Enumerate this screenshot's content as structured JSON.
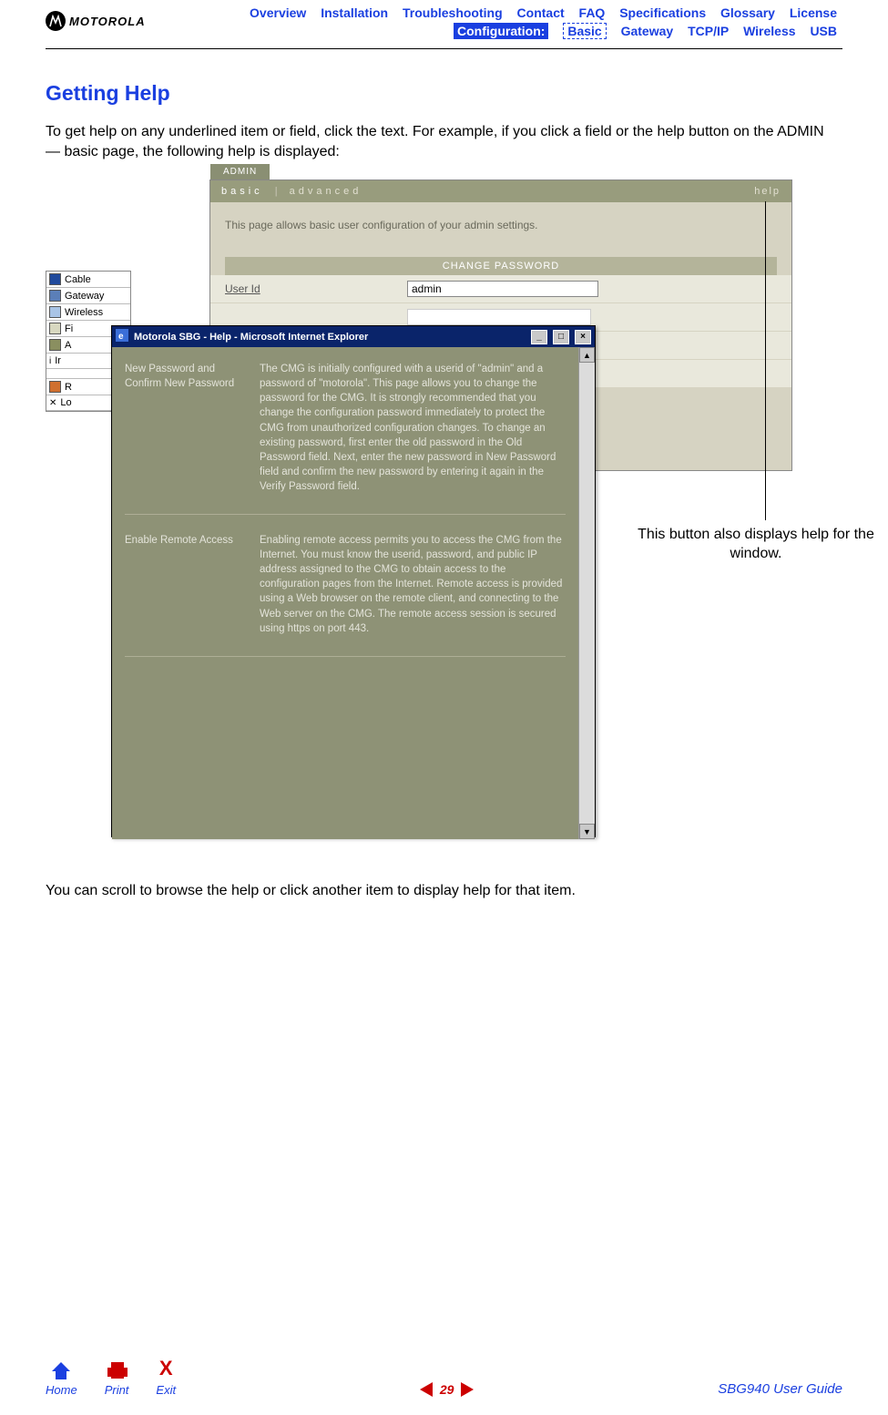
{
  "header": {
    "logo_text": "MOTOROLA",
    "nav1": [
      "Overview",
      "Installation",
      "Troubleshooting",
      "Contact",
      "FAQ",
      "Specifications",
      "Glossary",
      "License"
    ],
    "config_label": "Configuration:",
    "nav2": [
      "Basic",
      "Gateway",
      "TCP/IP",
      "Wireless",
      "USB"
    ]
  },
  "section_title": "Getting Help",
  "para1": "To get help on any underlined item or field, click the text. For example, if you click a field or the help button on the ADMIN — basic page, the following help is displayed:",
  "para2": "You can scroll to browse the help or click another item to display help for that item.",
  "callout": "This button also displays help for the window.",
  "admin": {
    "tab": "ADMIN",
    "sub_basic": "basic",
    "sub_sep": "|",
    "sub_adv": "advanced",
    "sub_help": "help",
    "desc": "This page allows basic user configuration of your admin settings.",
    "chpw": "CHANGE PASSWORD",
    "userid_label": "User Id",
    "userid_value": "admin"
  },
  "sidenav": {
    "items": [
      {
        "label": "Cable",
        "color": "#214a9c"
      },
      {
        "label": "Gateway",
        "color": "#5b7fb8"
      },
      {
        "label": "Wireless",
        "color": "#a9c4e6"
      },
      {
        "label": "Fi",
        "color": "#d8d8c0"
      },
      {
        "label": "A",
        "color": "#8a8f60"
      },
      {
        "label": "Ir",
        "color": "#fff"
      },
      {
        "label": "",
        "color": "#fff"
      },
      {
        "label": "R",
        "color": "#d07030"
      },
      {
        "label": "Lo",
        "color": "#bcbcbc"
      }
    ]
  },
  "help": {
    "title": "Motorola SBG - Help - Microsoft Internet Explorer",
    "min": "_",
    "max": "□",
    "close": "×",
    "up": "▲",
    "down": "▼",
    "rows": [
      {
        "k": "New Password and Confirm New Password",
        "v": "The CMG is initially configured with a userid of \"admin\" and a password of \"motorola\". This page allows you to change the password for the CMG. It is strongly recommended that you change the configuration password immediately to protect the CMG from unauthorized configuration changes. To change an existing password, first enter the old password in the Old Password field. Next, enter the new password in New Password field and confirm the new password by entering it again in the Verify Password field."
      },
      {
        "k": "Enable Remote Access",
        "v": "Enabling remote access permits you to access the CMG from the Internet. You must know the userid, password, and public IP address assigned to the CMG to obtain access to the configuration pages from the Internet. Remote access is provided using a Web browser on the remote client, and connecting to the Web server on the CMG. The remote access session is secured using https on port 443."
      }
    ]
  },
  "footer": {
    "home": "Home",
    "print": "Print",
    "exit_x": "X",
    "exit": "Exit",
    "page": "29",
    "guide": "SBG940 User Guide"
  }
}
